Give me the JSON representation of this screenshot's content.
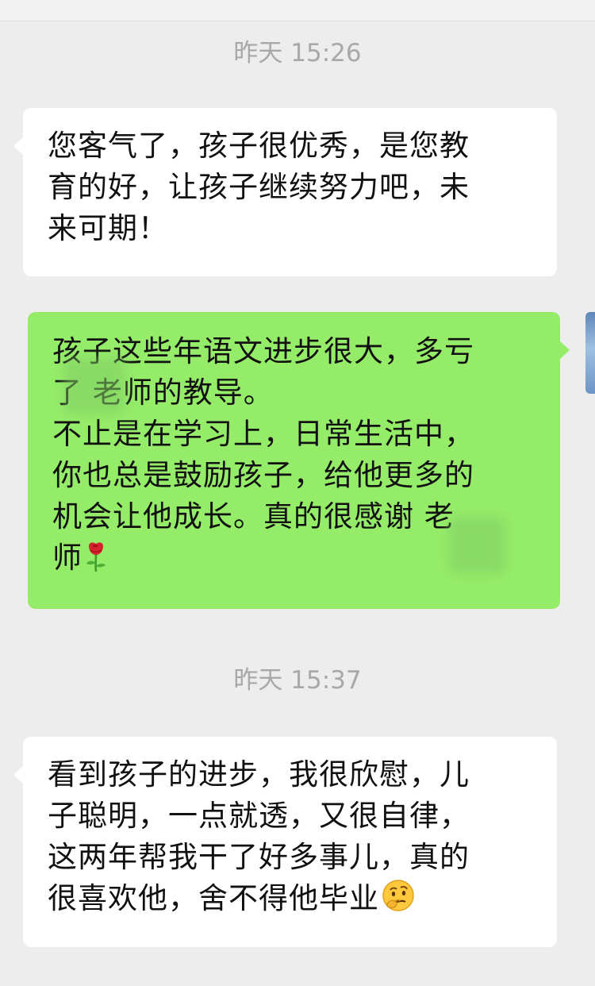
{
  "chat": {
    "messages": [
      {
        "type": "timestamp",
        "text": "昨天 15:26"
      },
      {
        "type": "incoming",
        "lines": [
          "您客气了，孩子很优秀，是您教",
          "育的好，让孩子继续努力吧，未",
          "来可期！"
        ]
      },
      {
        "type": "outgoing",
        "lines": [
          "孩子这些年语文进步很大，多亏",
          "了  老师的教导。",
          "不止是在学习上，日常生活中，",
          "你也总是鼓励孩子，给他更多的",
          "机会让他成长。真的很感谢  老",
          "师"
        ],
        "emoji": "rose"
      },
      {
        "type": "timestamp",
        "text": "昨天 15:37"
      },
      {
        "type": "incoming",
        "lines": [
          "看到孩子的进步，我很欣慰，儿",
          "子聪明，一点就透，又很自律，",
          "这两年帮我干了好多事儿，真的",
          "很喜欢他，舍不得他毕业"
        ],
        "emoji": "thinking-face"
      }
    ]
  },
  "colors": {
    "background": "#EDEDED",
    "incoming_bubble": "#FFFFFF",
    "outgoing_bubble": "#95EC69",
    "timestamp_text": "#A8A8A8",
    "message_text": "#111111"
  }
}
